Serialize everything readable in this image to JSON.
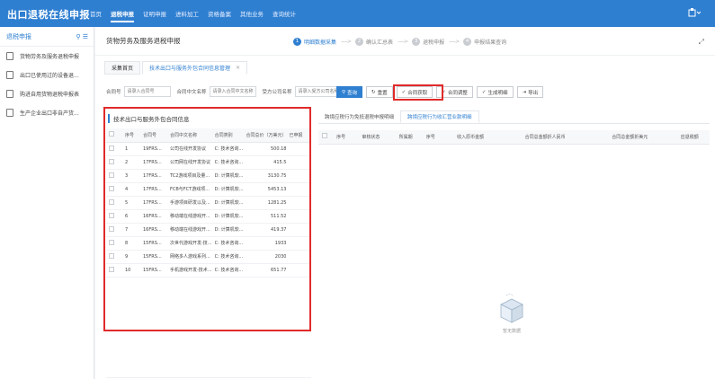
{
  "app": {
    "title": "出口退税在线申报"
  },
  "topnav": [
    "首页",
    "退税申报",
    "证明申报",
    "进料加工",
    "资格备案",
    "其他业务",
    "查询统计"
  ],
  "sidebar": {
    "title": "退税申报",
    "items": [
      "货物劳务及服务退税申报",
      "出口已使用过的设备退...",
      "购进自用货物退税申报表",
      "生产企业出口非自产货..."
    ]
  },
  "page": {
    "title": "货物劳务及服务退税申报"
  },
  "steps": [
    {
      "num": "1",
      "label": "明细数据采集"
    },
    {
      "num": "2",
      "label": "确认汇总表"
    },
    {
      "num": "3",
      "label": "退税申报"
    },
    {
      "num": "4",
      "label": "申报结果查询"
    }
  ],
  "tabs": {
    "home": "采集首页",
    "current": "技术出口与服务外包合同信息管理",
    "close": "×"
  },
  "filters": {
    "f1_label": "合同号",
    "f1_placeholder": "请录入合同号",
    "f2_label": "合同中文名称",
    "f2_placeholder": "请录入合同中文名称",
    "f3_label": "受方公司名称",
    "f3_placeholder": "请录入受方公司名称"
  },
  "buttons": {
    "query": "查询",
    "reset": "重置",
    "fetch": "合同获取",
    "adjust": "合同调整",
    "generate": "生成明细",
    "export": "导出"
  },
  "left_table": {
    "title": "技术出口与服务外包合同信息",
    "headers": [
      "序号",
      "合同号",
      "合同中文名称",
      "合同类别",
      "合同总价（万美元）",
      "已申报"
    ],
    "rows": [
      [
        "1",
        "19FRS...",
        "公司在线开发协议",
        "C: 技术咨询...",
        "500.18"
      ],
      [
        "2",
        "17FRS...",
        "公司网在线开发协议",
        "C: 技术咨询...",
        "415.5"
      ],
      [
        "3",
        "17FRS...",
        "TC2游戏项目及量...",
        "D: 计算机软...",
        "3130.75"
      ],
      [
        "4",
        "17FRS...",
        "FCB与FCT游戏项...",
        "D: 计算机软...",
        "5453.13"
      ],
      [
        "5",
        "17FRS...",
        "手游项目研发以及...",
        "D: 计算机软...",
        "1281.25"
      ],
      [
        "6",
        "16FRS...",
        "移动端在线游戏开...",
        "D: 计算机软...",
        "511.52"
      ],
      [
        "7",
        "16FRS...",
        "移动端在线游戏开...",
        "D: 计算机软...",
        "419.37"
      ],
      [
        "8",
        "15FRS...",
        "次世代游戏开发-技...",
        "C: 技术咨询...",
        "1933"
      ],
      [
        "9",
        "15FRS...",
        "网络多人游戏系列...",
        "C: 技术咨询...",
        "2030"
      ],
      [
        "10",
        "15FRS...",
        "手机游戏开发-技术...",
        "C: 技术咨询...",
        "651.77"
      ]
    ]
  },
  "right": {
    "tabs": [
      "跨境应税行为免抵退税申报明细",
      "跨境应税行为收汇营业款明细"
    ],
    "headers": [
      "序号",
      "审核状态",
      "所属期",
      "序号",
      "收入原币金额",
      "合同总金额折人民币",
      "合同总金额折美元",
      "应退税额"
    ],
    "empty": "暂无数据"
  }
}
